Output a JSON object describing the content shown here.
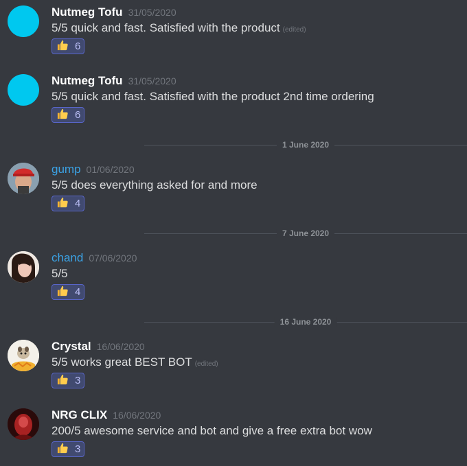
{
  "messages": [
    {
      "username": "Nutmeg Tofu",
      "timestamp": "31/05/2020",
      "text": "5/5 quick and fast. Satisfied with the product",
      "edited": "(edited)",
      "reaction_emoji": "thumbs-up-icon",
      "reaction_count": "6"
    },
    {
      "username": "Nutmeg Tofu",
      "timestamp": "31/05/2020",
      "text": "5/5 quick and fast. Satisfied with the product  2nd time ordering",
      "edited": "",
      "reaction_emoji": "thumbs-up-icon",
      "reaction_count": "6"
    },
    {
      "username": "gump",
      "timestamp": "01/06/2020",
      "text": "5/5 does everything asked for and more",
      "edited": "",
      "reaction_emoji": "thumbs-up-icon",
      "reaction_count": "4"
    },
    {
      "username": "chand",
      "timestamp": "07/06/2020",
      "text": "5/5",
      "edited": "",
      "reaction_emoji": "thumbs-up-icon",
      "reaction_count": "4"
    },
    {
      "username": "Crystal",
      "timestamp": "16/06/2020",
      "text": "5/5 works great BEST BOT",
      "edited": "(edited)",
      "reaction_emoji": "thumbs-up-icon",
      "reaction_count": "3"
    },
    {
      "username": "NRG CLIX",
      "timestamp": "16/06/2020",
      "text": "200/5 awesome service and bot and give a free extra bot wow",
      "edited": "",
      "reaction_emoji": "thumbs-up-icon",
      "reaction_count": "3"
    }
  ],
  "dividers": [
    "1 June 2020",
    "7 June 2020",
    "16 June 2020"
  ],
  "colors": {
    "background": "#36393f",
    "avatar_default": "#00c8ef",
    "username_blue": "#3ba3e6",
    "reaction_bg": "#414a70",
    "reaction_border": "#5865c8"
  }
}
